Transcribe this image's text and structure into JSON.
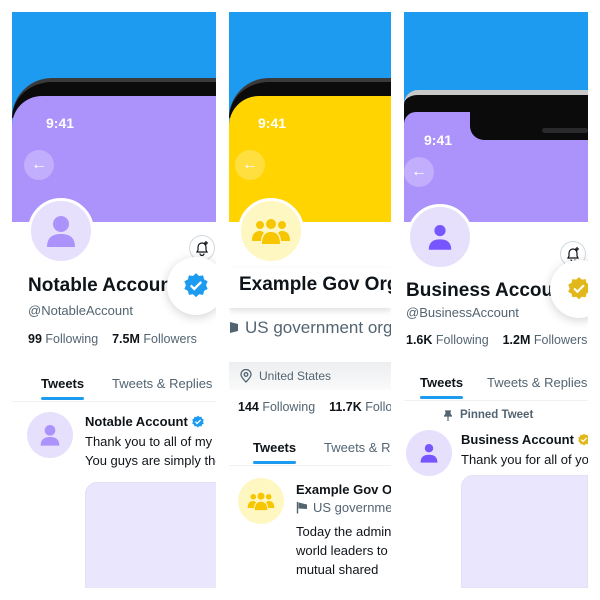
{
  "status_time": "9:41",
  "colors": {
    "sky": "#1d9bf0",
    "banner_purple": "#ac93fb",
    "banner_yellow": "#ffd400",
    "verified_blue": "#1d9bf0",
    "verified_gold": "#e2b719",
    "avatar_purple_bg": "#e6e0fd",
    "avatar_purple_fg": "#ac93fb",
    "avatar_yellow_bg": "#fff7c2",
    "avatar_yellow_fg": "#f7c600"
  },
  "panels": [
    {
      "account_type": "notable",
      "name": "Notable Account",
      "handle": "@NotableAccount",
      "following_count": "99",
      "following_label": "Following",
      "followers_count": "7.5M",
      "followers_label": "Followers",
      "badge": "blue-verified-icon",
      "tabs": [
        "Tweets",
        "Tweets & Replies"
      ],
      "tweet": {
        "name": "Notable Account",
        "lines": [
          "Thank you to all of my fans",
          "You guys are simply the best"
        ]
      }
    },
    {
      "account_type": "government",
      "name": "Example Gov Org",
      "label": "US government organization",
      "location": "United States",
      "following_count": "144",
      "following_label": "Following",
      "followers_count": "11.7K",
      "followers_label": "Followers",
      "tabs": [
        "Tweets",
        "Tweets & Replies"
      ],
      "tweet": {
        "name": "Example Gov Org",
        "label": "US government organization",
        "lines": [
          "Today the administration met with",
          "world leaders to discuss",
          "mutual shared"
        ]
      }
    },
    {
      "account_type": "business",
      "name": "Business Account",
      "handle": "@BusinessAccount",
      "following_count": "1.6K",
      "following_label": "Following",
      "followers_count": "1.2M",
      "followers_label": "Followers",
      "badge": "gold-verified-icon",
      "tabs": [
        "Tweets",
        "Tweets & Replies"
      ],
      "pinned_label": "Pinned Tweet",
      "tweet": {
        "name": "Business Account",
        "lines": [
          "Thank you for all of your support"
        ]
      }
    }
  ]
}
